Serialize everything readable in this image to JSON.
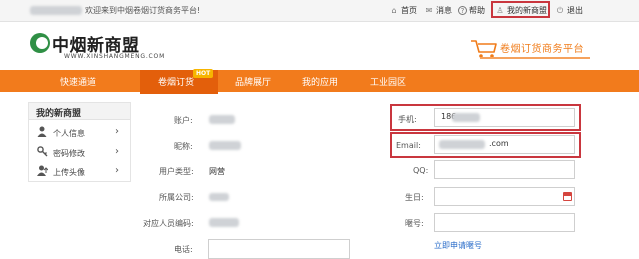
{
  "topbar": {
    "welcome": "欢迎来到中烟卷烟订货商务平台!",
    "links": [
      {
        "icon": "home-icon",
        "glyph": "⌂",
        "label": "首页"
      },
      {
        "icon": "mail-icon",
        "glyph": "✉",
        "label": "消息"
      },
      {
        "icon": "help-icon",
        "glyph": "?",
        "label": "帮助"
      },
      {
        "icon": "user-icon",
        "glyph": "♙",
        "label": "我的新商盟"
      },
      {
        "icon": "logout-icon",
        "glyph": "⏻",
        "label": "退出"
      }
    ]
  },
  "header": {
    "logo_text": "中烟新商盟",
    "logo_sub": "WWW.XINSHANGMENG.COM",
    "slogan": "卷烟订货商务平台"
  },
  "nav": {
    "items": [
      "快速通道",
      "卷烟订货",
      "品牌展厅",
      "我的应用",
      "工业园区"
    ],
    "active_index": 1,
    "hot_badge": "HOT"
  },
  "sidebar": {
    "title": "我的新商盟",
    "items": [
      {
        "icon": "person-icon",
        "glyph": "👤",
        "label": "个人信息"
      },
      {
        "icon": "key-icon",
        "glyph": "⚷",
        "label": "密码修改"
      },
      {
        "icon": "upload-avatar-icon",
        "glyph": "👤",
        "label": "上传头像"
      }
    ]
  },
  "form": {
    "left": {
      "account_label": "账户:",
      "nickname_label": "昵称:",
      "user_type_label": "用户类型:",
      "user_type_value": "网营",
      "company_label": "所属公司:",
      "contact_code_label": "对应人员编码:",
      "phone_label": "电话:"
    },
    "right": {
      "mobile_label": "手机:",
      "mobile_value": "186",
      "email_label": "Email:",
      "email_value": ".com",
      "qq_label": "QQ:",
      "birthday_label": "生日:",
      "alias_label": "暱号:",
      "apply_link": "立即申请暱号"
    }
  },
  "colors": {
    "nav_orange": "#f27b1c",
    "nav_active": "#e35f0b",
    "highlight_red": "#c9363e",
    "link_blue": "#2a6cc9",
    "brand_green": "#2f8f45"
  }
}
